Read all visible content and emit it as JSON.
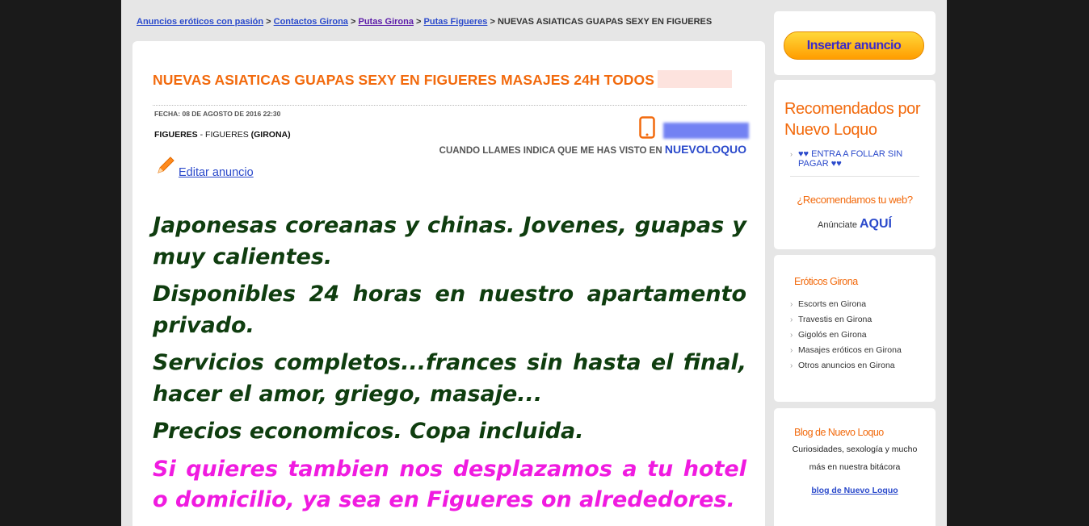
{
  "breadcrumb": {
    "items": [
      "Anuncios eróticos con pasión",
      "Contactos Girona",
      "Putas Girona",
      "Putas Figueres"
    ],
    "current": "NUEVAS ASIATICAS GUAPAS SEXY EN FIGUERES",
    "separator": ">"
  },
  "ad": {
    "title": "NUEVAS ASIATICAS GUAPAS SEXY EN FIGUERES MASAJES 24H TODOS",
    "fecha": "FECHA: 08 DE AGOSTO DE 2016 22:30",
    "city": "FIGUERES",
    "location_sep": " - ",
    "area": "FIGUERES",
    "province": "(GIRONA)",
    "call_note": "CUANDO LLAMES INDICA QUE ME HAS VISTO EN",
    "brand": "NUEVOLOQUO",
    "edit_label": "Editar anuncio",
    "paragraphs": [
      "Japonesas coreanas y chinas. Jovenes, guapas y muy calientes.",
      "Disponibles 24 horas en nuestro apartamento privado.",
      "Servicios completos...frances sin hasta el final, hacer el amor, griego, masaje...",
      "Precios economicos. Copa incluida."
    ],
    "highlight": "Si quieres tambien nos desplazamos a tu hotel o domicilio, ya sea en Figueres on alrededores."
  },
  "sidebar": {
    "insert_button": "Insertar anuncio",
    "recommended": {
      "title": "Recomendados por Nuevo Loquo",
      "item": "♥♥ ENTRA A FOLLAR SIN PAGAR ♥♥",
      "web_question": "¿Recomendamos tu web?",
      "anunciate": "Anúnciate",
      "aqui": "AQUÍ"
    },
    "eroticos": {
      "title": "Eróticos Girona",
      "items": [
        "Escorts en Girona",
        "Travestis en Girona",
        "Gigolós en Girona",
        "Masajes eróticos en Girona",
        "Otros anuncios en Girona"
      ]
    },
    "blog": {
      "title": "Blog de Nuevo Loquo",
      "desc_line1": "Curiosidades, sexología y mucho",
      "desc_line2": "más en nuestra bitácora",
      "link": "blog de Nuevo Loquo"
    }
  },
  "colors": {
    "accent_orange": "#f26a0d",
    "link_blue": "#2b4acb",
    "body_green": "#0f3d0f",
    "highlight_pink": "#f01be0"
  },
  "icons": [
    "phone-icon",
    "pencil-icon",
    "chevron-right-icon"
  ]
}
